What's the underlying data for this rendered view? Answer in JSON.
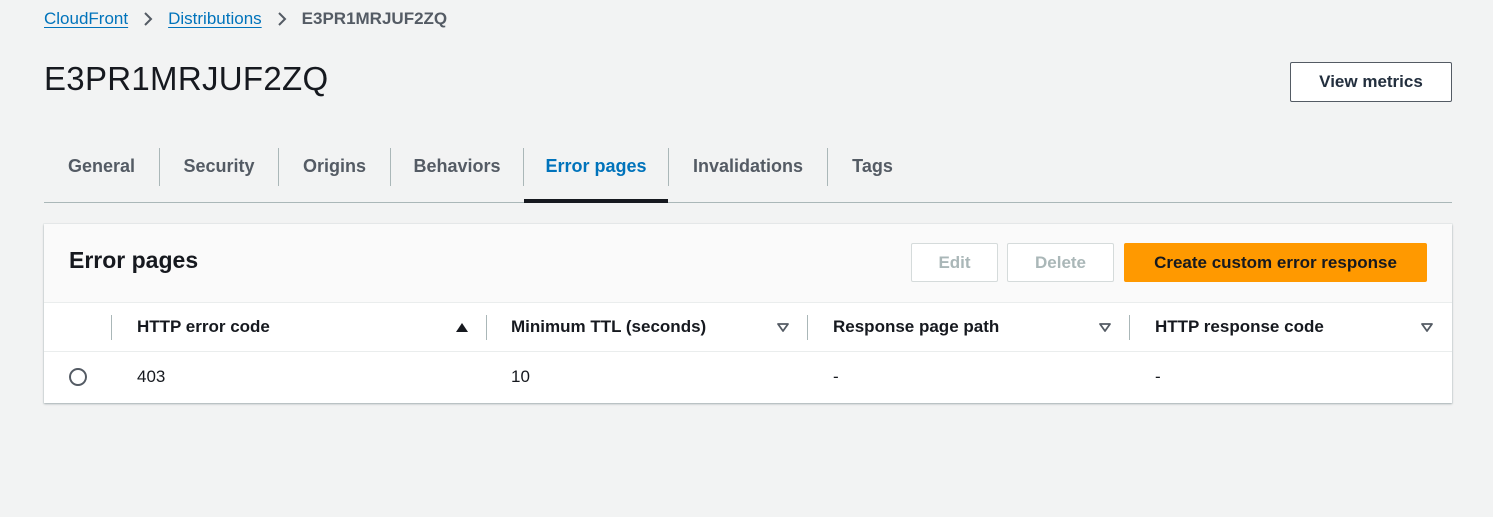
{
  "breadcrumb": {
    "items": [
      {
        "label": "CloudFront"
      },
      {
        "label": "Distributions"
      }
    ],
    "current": "E3PR1MRJUF2ZQ"
  },
  "header": {
    "title": "E3PR1MRJUF2ZQ",
    "view_metrics_label": "View metrics"
  },
  "tabs": [
    {
      "label": "General"
    },
    {
      "label": "Security"
    },
    {
      "label": "Origins"
    },
    {
      "label": "Behaviors"
    },
    {
      "label": "Error pages",
      "active": true
    },
    {
      "label": "Invalidations"
    },
    {
      "label": "Tags"
    }
  ],
  "panel": {
    "title": "Error pages",
    "edit_label": "Edit",
    "delete_label": "Delete",
    "create_label": "Create custom error response"
  },
  "table": {
    "columns": [
      {
        "label": "HTTP error code",
        "sort": "ascending"
      },
      {
        "label": "Minimum TTL (seconds)",
        "sort": "none"
      },
      {
        "label": "Response page path",
        "sort": "none"
      },
      {
        "label": "HTTP response code",
        "sort": "none"
      }
    ],
    "rows": [
      {
        "selected": false,
        "cells": [
          "403",
          "10",
          "-",
          "-"
        ]
      }
    ]
  },
  "colors": {
    "link": "#0073bb",
    "primary_button": "#ff9900",
    "background": "#f2f3f3"
  }
}
